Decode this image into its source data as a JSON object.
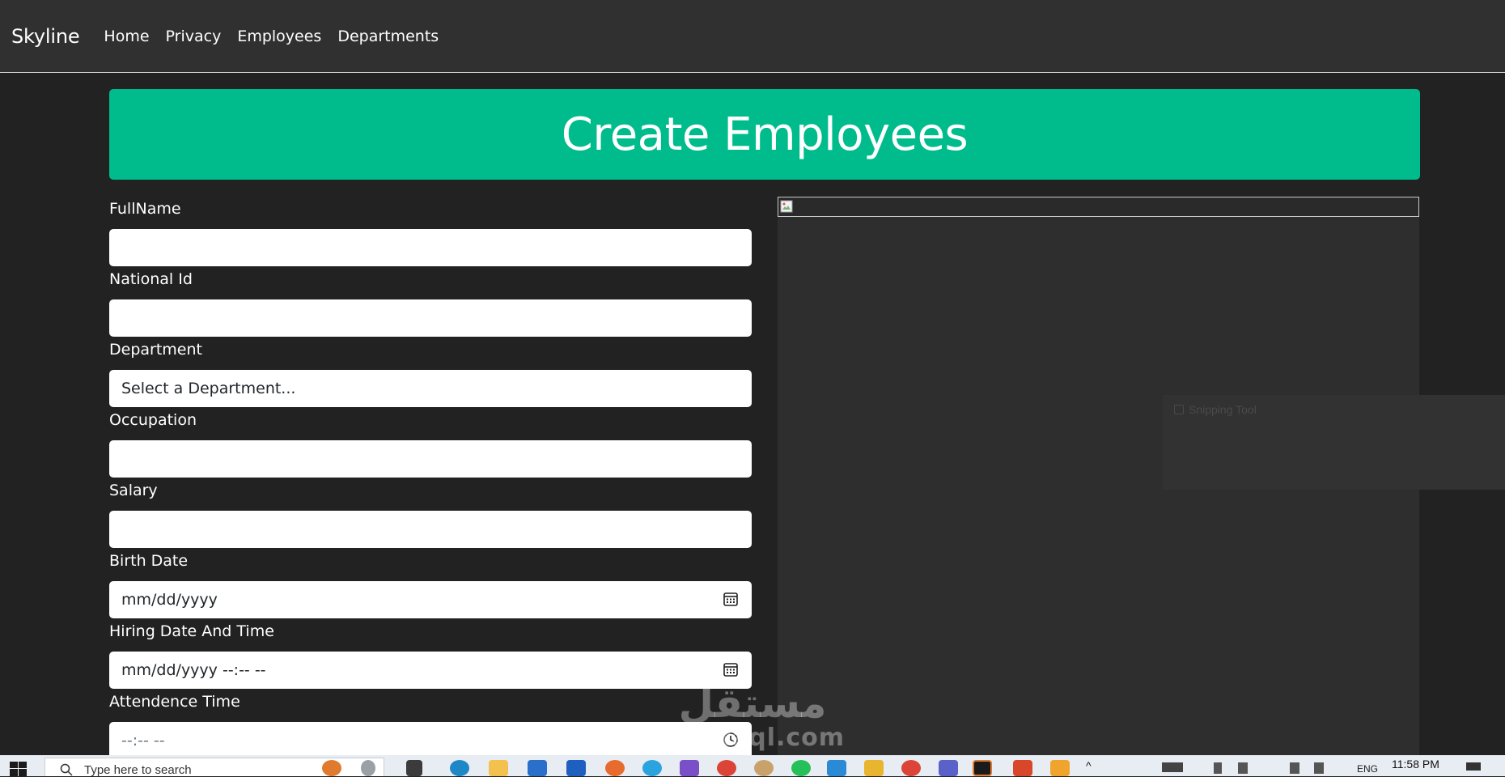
{
  "navbar": {
    "brand": "Skyline",
    "links": [
      "Home",
      "Privacy",
      "Employees",
      "Departments"
    ]
  },
  "header": {
    "title": "Create Employees"
  },
  "form": {
    "fields": [
      {
        "label": "FullName",
        "value": "",
        "placeholder": ""
      },
      {
        "label": "National Id",
        "value": "",
        "placeholder": ""
      },
      {
        "label": "Department",
        "value": "Select a Department...",
        "placeholder": ""
      },
      {
        "label": "Occupation",
        "value": "",
        "placeholder": ""
      },
      {
        "label": "Salary",
        "value": "",
        "placeholder": ""
      },
      {
        "label": "Birth Date",
        "value": "mm/dd/yyyy",
        "placeholder": ""
      },
      {
        "label": "Hiring Date And Time",
        "value": "mm/dd/yyyy --:-- --",
        "placeholder": ""
      },
      {
        "label": "Attendence Time",
        "value": "--:-- --",
        "placeholder": ""
      }
    ]
  },
  "overlay": {
    "snipping_tool_title": "Snipping Tool"
  },
  "watermark": {
    "arabic": "مستقل",
    "latin": "mostaql.com"
  },
  "taskbar": {
    "search_placeholder": "Type here to search",
    "language": "ENG",
    "clock": "11:58 PM"
  },
  "colors": {
    "accent": "#00bc8c",
    "background": "#222222",
    "navbar": "#303030"
  }
}
